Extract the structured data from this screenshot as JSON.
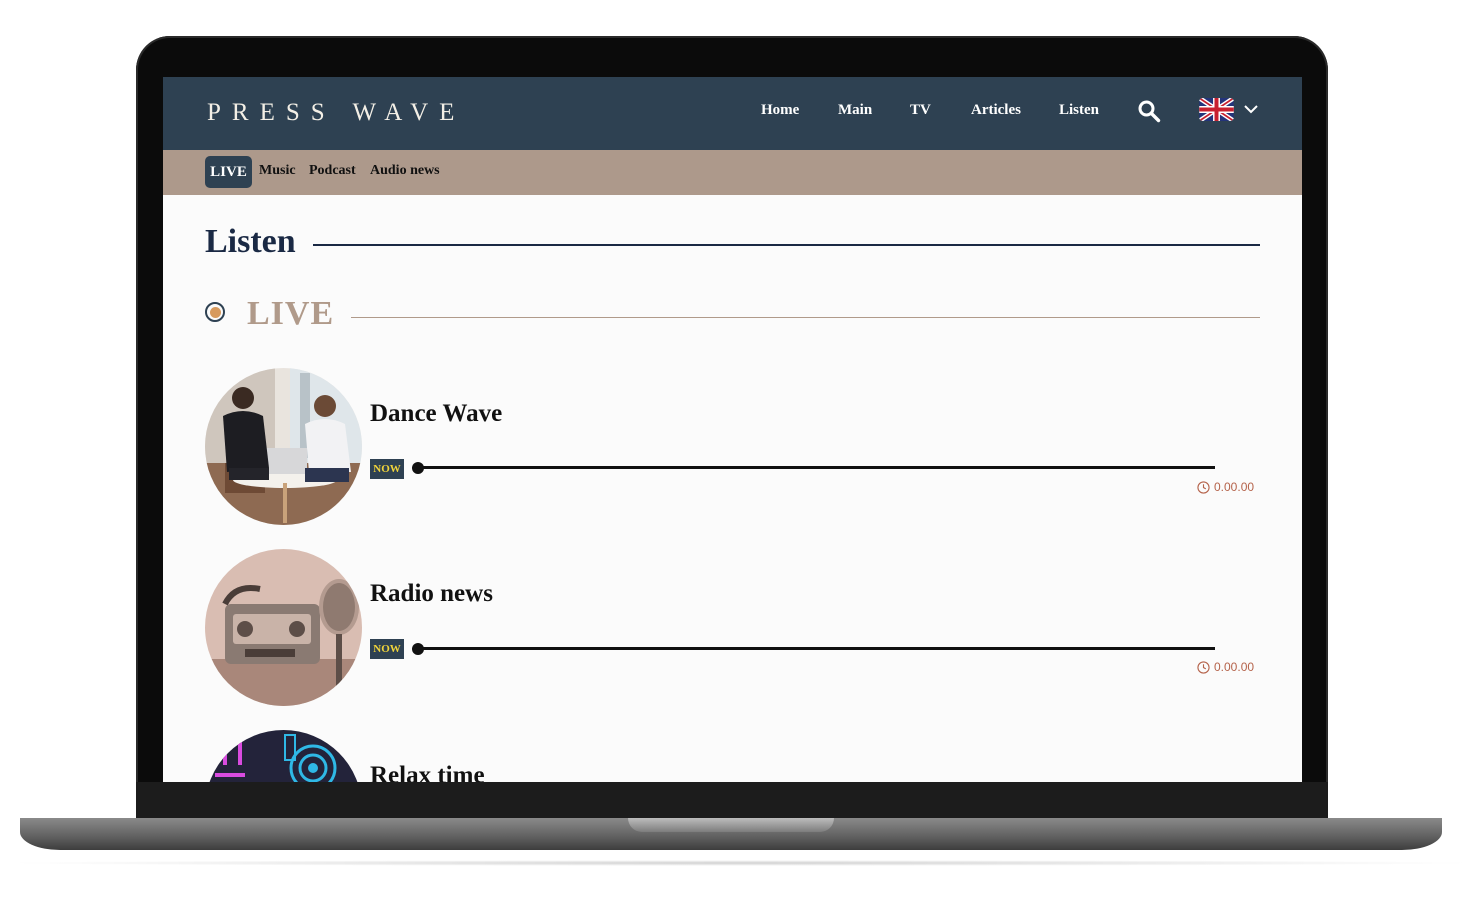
{
  "header": {
    "logo": "PRESS WAVE",
    "nav": [
      "Home",
      "Main",
      "TV",
      "Articles",
      "Listen"
    ],
    "language": "English (UK)"
  },
  "subnav": {
    "active": "LIVE",
    "items": [
      "Music",
      "Podcast",
      "Audio news"
    ]
  },
  "page": {
    "title": "Listen",
    "section": "LIVE"
  },
  "stations": [
    {
      "name": "Dance Wave",
      "badge": "NOW",
      "time": "0.00.00",
      "progress": 0
    },
    {
      "name": "Radio news",
      "badge": "NOW",
      "time": "0.00.00",
      "progress": 0
    },
    {
      "name": "Relax time"
    }
  ],
  "colors": {
    "header_bg": "#2e4152",
    "subnav_bg": "#ad998b",
    "accent": "#b09a8a",
    "badge_text": "#f0d43a",
    "time_text": "#b5634b"
  },
  "icons": [
    "search-icon",
    "uk-flag-icon",
    "chevron-down-icon",
    "clock-icon"
  ]
}
